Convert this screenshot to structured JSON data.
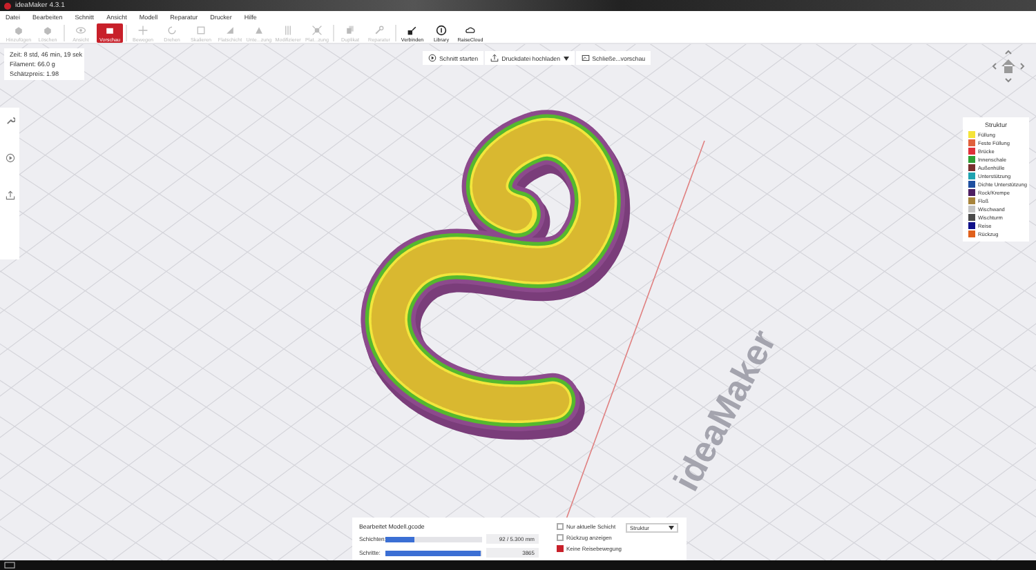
{
  "window": {
    "title": "ideaMaker 4.3.1"
  },
  "menu": [
    "Datei",
    "Bearbeiten",
    "Schnitt",
    "Ansicht",
    "Modell",
    "Reparatur",
    "Drucker",
    "Hilfe"
  ],
  "toolbar": [
    {
      "label": "Hinzufügen",
      "selected": false,
      "disabled": true
    },
    {
      "label": "Löschen",
      "selected": false,
      "disabled": true
    },
    {
      "label": "Ansicht",
      "selected": false,
      "disabled": true
    },
    {
      "label": "Vorschau",
      "selected": true,
      "disabled": false
    },
    {
      "label": "Bewegen",
      "selected": false,
      "disabled": true
    },
    {
      "label": "Drehen",
      "selected": false,
      "disabled": true
    },
    {
      "label": "Skalieren",
      "selected": false,
      "disabled": true
    },
    {
      "label": "Flatschicht",
      "selected": false,
      "disabled": true
    },
    {
      "label": "Unte...zung",
      "selected": false,
      "disabled": true
    },
    {
      "label": "Modifizierer",
      "selected": false,
      "disabled": true
    },
    {
      "label": "Plat...zung",
      "selected": false,
      "disabled": true
    },
    {
      "label": "Duplikat",
      "selected": false,
      "disabled": true
    },
    {
      "label": "Reparatur",
      "selected": false,
      "disabled": true
    },
    {
      "label": "Verbinden",
      "selected": false,
      "disabled": false
    },
    {
      "label": "Library",
      "selected": false,
      "disabled": false
    },
    {
      "label": "RaiseCloud",
      "selected": false,
      "disabled": false
    }
  ],
  "info": [
    "Zeit: 8 std, 46 min, 19 sek",
    "Filament: 66.0 g",
    "Schätzpreis: 1.98"
  ],
  "actions": [
    {
      "label": "Schnitt starten",
      "dropdown": false
    },
    {
      "label": "Druckdatei hochladen",
      "dropdown": true
    },
    {
      "label": "Schließe...vorschau",
      "dropdown": false
    }
  ],
  "plate_logo": "ideaMaker",
  "legend": {
    "title": "Struktur",
    "items": [
      {
        "label": "Füllung",
        "color": "#f5e43a"
      },
      {
        "label": "Feste Füllung",
        "color": "#e0603c"
      },
      {
        "label": "Brücke",
        "color": "#e0303a"
      },
      {
        "label": "Innenschale",
        "color": "#2f9e36"
      },
      {
        "label": "Außenhülle",
        "color": "#7a2e2e"
      },
      {
        "label": "Unterstützung",
        "color": "#1fa3b0"
      },
      {
        "label": "Dichte Unterstützung",
        "color": "#1f4fa0"
      },
      {
        "label": "Rock/Krempe",
        "color": "#4e1f62"
      },
      {
        "label": "Floß",
        "color": "#a8843c"
      },
      {
        "label": "Wischwand",
        "color": "#c4c4c4"
      },
      {
        "label": "Wischturm",
        "color": "#4a4a4a"
      },
      {
        "label": "Reise",
        "color": "#10108a"
      },
      {
        "label": "Rückzug",
        "color": "#e0601c"
      }
    ]
  },
  "preview_panel": {
    "title": "Bearbeitet Modell.gcode",
    "sliders": [
      {
        "label": "Schichten:",
        "level": 0.3,
        "reading": "92 / 5.300 mm"
      },
      {
        "label": "Schritte:",
        "level": 0.98,
        "reading": "3865"
      }
    ],
    "options": [
      {
        "label": "Nur aktuelle Schicht",
        "checked": false
      },
      {
        "label": "Rückzug anzeigen",
        "checked": false
      },
      {
        "label": "Keine Reisebewegung",
        "checked": true
      }
    ],
    "view_select": {
      "value": "Struktur"
    }
  }
}
